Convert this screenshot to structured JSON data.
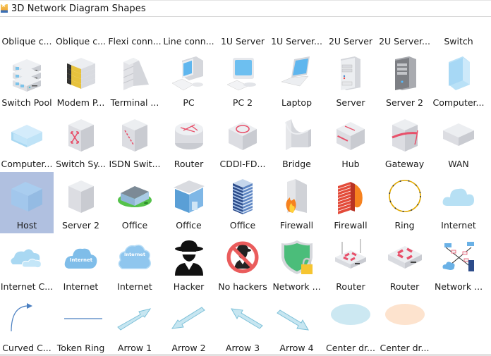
{
  "panel": {
    "title": "3D Network Diagram Shapes",
    "title_icon": "library-star-icon"
  },
  "shapes": [
    {
      "label": "Oblique c...",
      "icon": "oblique-connector-icon"
    },
    {
      "label": "Oblique c...",
      "icon": "oblique-connector-2-icon"
    },
    {
      "label": "Flexi conn...",
      "icon": "flexi-connector-icon"
    },
    {
      "label": "Line conn...",
      "icon": "line-connector-icon"
    },
    {
      "label": "1U Server",
      "icon": "1u-server-icon"
    },
    {
      "label": "1U Server...",
      "icon": "1u-server-2-icon"
    },
    {
      "label": "2U Server",
      "icon": "2u-server-icon"
    },
    {
      "label": "2U Server...",
      "icon": "2u-server-2-icon"
    },
    {
      "label": "Switch",
      "icon": "switch-icon"
    },
    {
      "label": "Switch Pool",
      "icon": "switch-pool-icon"
    },
    {
      "label": "Modem P...",
      "icon": "modem-pool-icon"
    },
    {
      "label": "Terminal ...",
      "icon": "terminal-server-icon"
    },
    {
      "label": "PC",
      "icon": "pc-icon"
    },
    {
      "label": "PC 2",
      "icon": "pc-2-icon"
    },
    {
      "label": "Laptop",
      "icon": "laptop-icon"
    },
    {
      "label": "Server",
      "icon": "server-icon"
    },
    {
      "label": "Server 2",
      "icon": "server-2-icon"
    },
    {
      "label": "Computer...",
      "icon": "computer-box-icon"
    },
    {
      "label": "Computer...",
      "icon": "computer-box-2-icon"
    },
    {
      "label": "Switch Sy...",
      "icon": "switch-system-icon"
    },
    {
      "label": "ISDN Swit...",
      "icon": "isdn-switch-icon"
    },
    {
      "label": "Router",
      "icon": "router-cylinder-icon"
    },
    {
      "label": "CDDI-FD...",
      "icon": "cddi-fddi-icon"
    },
    {
      "label": "Bridge",
      "icon": "bridge-icon"
    },
    {
      "label": "Hub",
      "icon": "hub-icon"
    },
    {
      "label": "Gateway",
      "icon": "gateway-icon"
    },
    {
      "label": "WAN",
      "icon": "wan-icon"
    },
    {
      "label": "Host",
      "icon": "host-icon",
      "selected": true
    },
    {
      "label": "Server 2",
      "icon": "server-block-icon"
    },
    {
      "label": "Office",
      "icon": "office-campus-icon"
    },
    {
      "label": "Office",
      "icon": "office-building-icon"
    },
    {
      "label": "Office",
      "icon": "office-tower-icon"
    },
    {
      "label": "Firewall",
      "icon": "firewall-gray-icon"
    },
    {
      "label": "Firewall",
      "icon": "firewall-red-icon"
    },
    {
      "label": "Ring",
      "icon": "ring-icon"
    },
    {
      "label": "Internet",
      "icon": "internet-cloud-icon"
    },
    {
      "label": "Internet C...",
      "icon": "internet-clouds-icon"
    },
    {
      "label": "Internet",
      "icon": "internet-labeled-cloud-icon"
    },
    {
      "label": "Internet",
      "icon": "internet-labeled-cloud-2-icon"
    },
    {
      "label": "Hacker",
      "icon": "hacker-icon"
    },
    {
      "label": "No hackers",
      "icon": "no-hackers-icon"
    },
    {
      "label": "Network ...",
      "icon": "network-security-icon"
    },
    {
      "label": "Router",
      "icon": "wifi-router-icon"
    },
    {
      "label": "Router",
      "icon": "router-box-icon"
    },
    {
      "label": "Network ...",
      "icon": "network-topology-icon"
    },
    {
      "label": "Curved C...",
      "icon": "curved-connector-icon"
    },
    {
      "label": "Token Ring",
      "icon": "token-ring-line-icon"
    },
    {
      "label": "Arrow 1",
      "icon": "arrow-up-right-icon"
    },
    {
      "label": "Arrow 2",
      "icon": "arrow-down-left-icon"
    },
    {
      "label": "Arrow 3",
      "icon": "arrow-up-left-icon"
    },
    {
      "label": "Arrow 4",
      "icon": "arrow-down-right-icon"
    },
    {
      "label": "Center dr...",
      "icon": "ellipse-blue-icon"
    },
    {
      "label": "Center dr...",
      "icon": "ellipse-orange-icon"
    }
  ],
  "colors": {
    "selection": "#b0c0e0",
    "accent_red": "#e8506a",
    "light_blue": "#a9d8f2",
    "cube_gray": "#dcdde2"
  }
}
